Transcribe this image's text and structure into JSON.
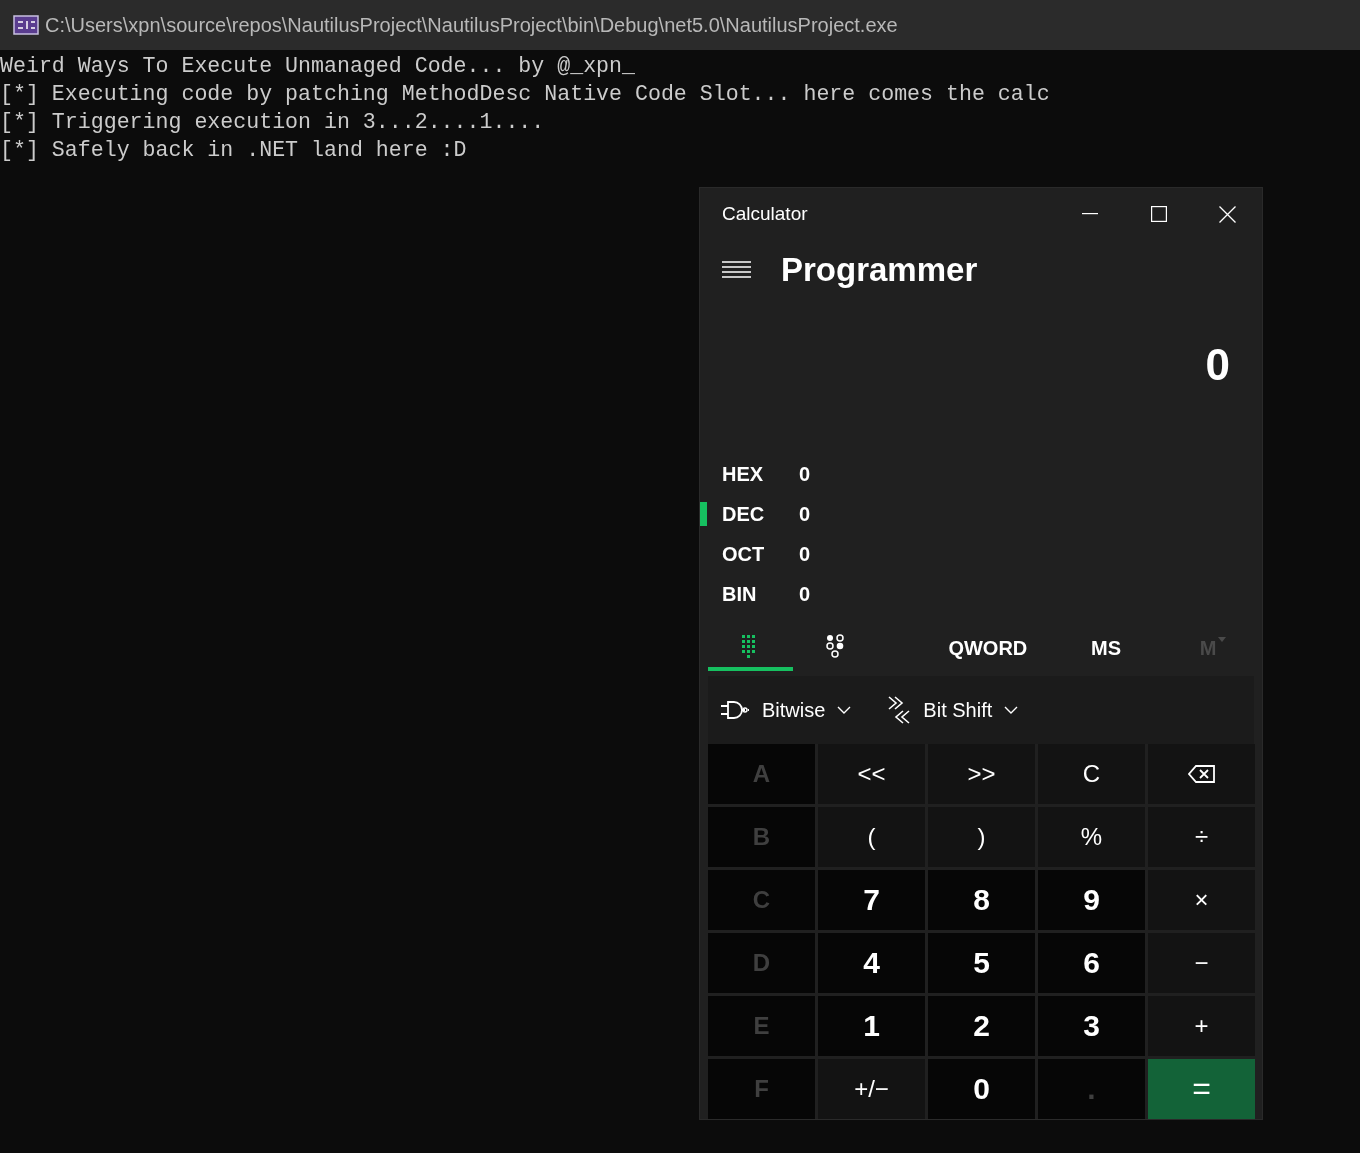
{
  "console": {
    "title": "C:\\Users\\xpn\\source\\repos\\NautilusProject\\NautilusProject\\bin\\Debug\\net5.0\\NautilusProject.exe",
    "lines": [
      "Weird Ways To Execute Unmanaged Code... by @_xpn_",
      "[*] Executing code by patching MethodDesc Native Code Slot... here comes the calc",
      "[*] Triggering execution in 3...2....1....",
      "[*] Safely back in .NET land here :D"
    ]
  },
  "calculator": {
    "title": "Calculator",
    "mode": "Programmer",
    "display": "0",
    "radix": [
      {
        "label": "HEX",
        "value": "0",
        "selected": false
      },
      {
        "label": "DEC",
        "value": "0",
        "selected": true
      },
      {
        "label": "OCT",
        "value": "0",
        "selected": false
      },
      {
        "label": "BIN",
        "value": "0",
        "selected": false
      }
    ],
    "tabs": [
      {
        "kind": "keypad",
        "selected": true
      },
      {
        "kind": "bits",
        "selected": false
      }
    ],
    "word_size": "QWORD",
    "memory": [
      {
        "label": "MS",
        "disabled": false,
        "kind": "plain"
      },
      {
        "label": "M",
        "disabled": true,
        "kind": "dropdown"
      }
    ],
    "menus": [
      {
        "label": "Bitwise",
        "kind": "bitwise"
      },
      {
        "label": "Bit Shift",
        "kind": "shift"
      }
    ],
    "keys": [
      {
        "label": "A",
        "kind": "hex",
        "disabled": true
      },
      {
        "label": "<<",
        "kind": "op",
        "disabled": false
      },
      {
        "label": ">>",
        "kind": "op",
        "disabled": false
      },
      {
        "label": "C",
        "kind": "op",
        "disabled": false
      },
      {
        "kind": "backspace",
        "disabled": false
      },
      {
        "label": "B",
        "kind": "hex",
        "disabled": true
      },
      {
        "label": "(",
        "kind": "op",
        "disabled": false
      },
      {
        "label": ")",
        "kind": "op",
        "disabled": false
      },
      {
        "label": "%",
        "kind": "op",
        "disabled": false
      },
      {
        "label": "÷",
        "kind": "op",
        "disabled": false
      },
      {
        "label": "C",
        "kind": "hex",
        "disabled": true
      },
      {
        "label": "7",
        "kind": "digit",
        "disabled": false
      },
      {
        "label": "8",
        "kind": "digit",
        "disabled": false
      },
      {
        "label": "9",
        "kind": "digit",
        "disabled": false
      },
      {
        "label": "×",
        "kind": "op",
        "disabled": false
      },
      {
        "label": "D",
        "kind": "hex",
        "disabled": true
      },
      {
        "label": "4",
        "kind": "digit",
        "disabled": false
      },
      {
        "label": "5",
        "kind": "digit",
        "disabled": false
      },
      {
        "label": "6",
        "kind": "digit",
        "disabled": false
      },
      {
        "label": "−",
        "kind": "op",
        "disabled": false
      },
      {
        "label": "E",
        "kind": "hex",
        "disabled": true
      },
      {
        "label": "1",
        "kind": "digit",
        "disabled": false
      },
      {
        "label": "2",
        "kind": "digit",
        "disabled": false
      },
      {
        "label": "3",
        "kind": "digit",
        "disabled": false
      },
      {
        "label": "+",
        "kind": "op",
        "disabled": false
      },
      {
        "label": "F",
        "kind": "hex",
        "disabled": true
      },
      {
        "label": "+/−",
        "kind": "op",
        "disabled": false
      },
      {
        "label": "0",
        "kind": "digit",
        "disabled": false
      },
      {
        "label": ".",
        "kind": "digit",
        "disabled": true
      },
      {
        "label": "=",
        "kind": "equals",
        "disabled": false
      }
    ]
  }
}
